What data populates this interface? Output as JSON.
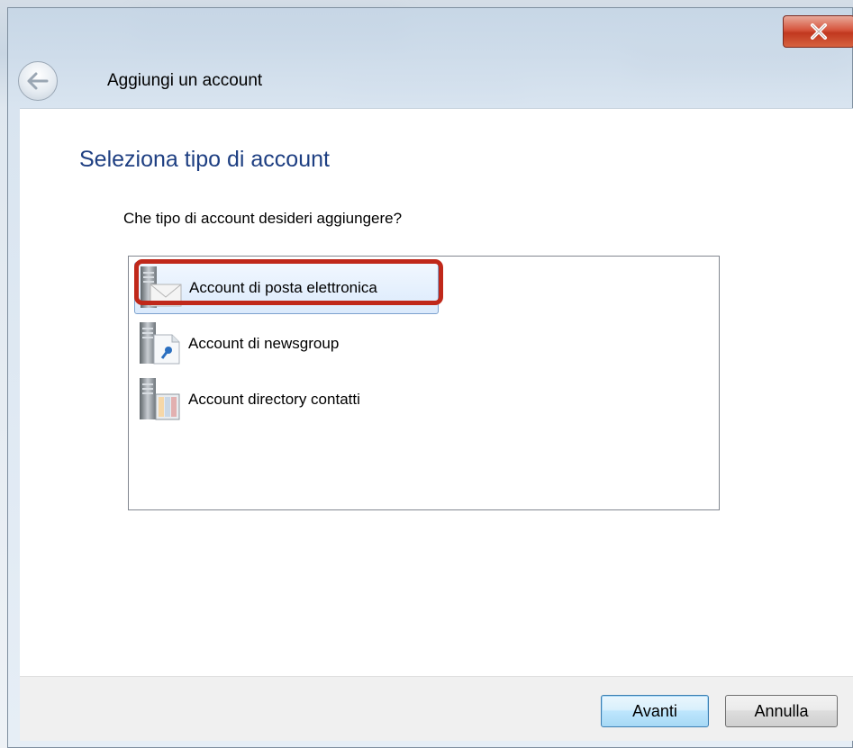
{
  "window": {
    "title": "Aggiungi un account",
    "close_icon": "close-icon",
    "back_icon": "back-arrow-icon"
  },
  "page": {
    "heading": "Seleziona tipo di account",
    "question": "Che tipo di account desideri aggiungere?"
  },
  "account_types": {
    "items": [
      {
        "label": "Account di posta elettronica",
        "icon": "mail-server-icon",
        "selected": true
      },
      {
        "label": "Account di newsgroup",
        "icon": "newsgroup-server-icon",
        "selected": false
      },
      {
        "label": "Account directory contatti",
        "icon": "directory-server-icon",
        "selected": false
      }
    ]
  },
  "footer": {
    "next_label": "Avanti",
    "cancel_label": "Annulla"
  },
  "colors": {
    "heading": "#1e3f82",
    "highlight": "#c0281a",
    "close_button": "#c1381f"
  }
}
